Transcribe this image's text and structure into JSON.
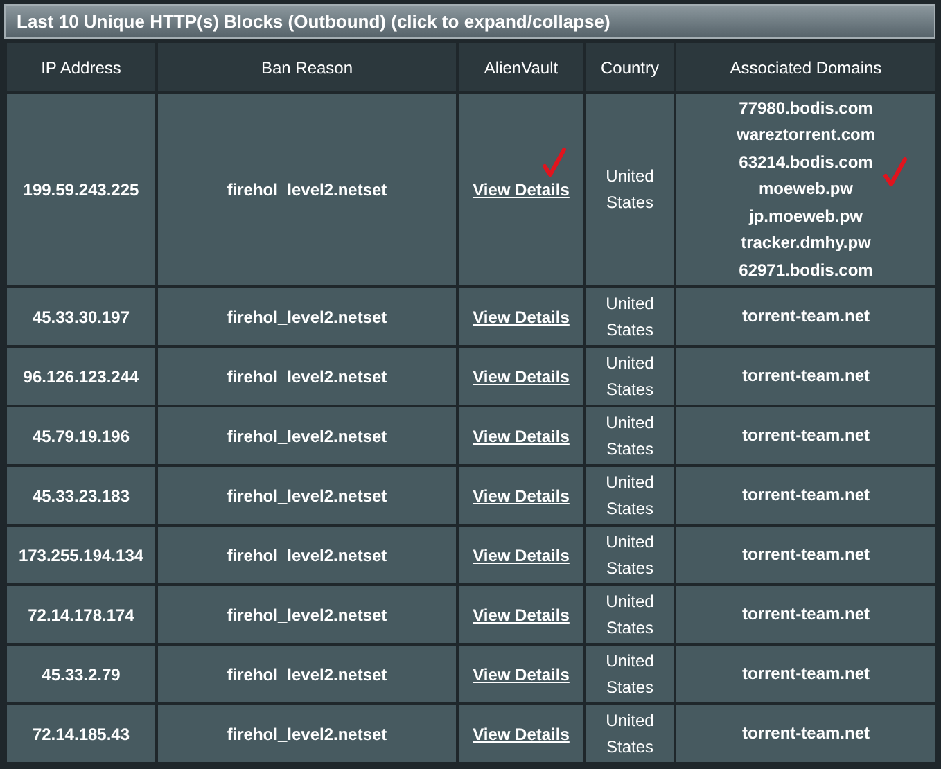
{
  "panel": {
    "title": "Last 10 Unique HTTP(s) Blocks (Outbound) (click to expand/collapse)"
  },
  "table": {
    "columns": [
      "IP Address",
      "Ban Reason",
      "AlienVault",
      "Country",
      "Associated Domains"
    ],
    "rows": [
      {
        "ip": "199.59.243.225",
        "reason": "firehol_level2.netset",
        "link": "View Details",
        "link_checked": true,
        "country": "United States",
        "domains": [
          "77980.bodis.com",
          "wareztorrent.com",
          "63214.bodis.com",
          "moeweb.pw",
          "jp.moeweb.pw",
          "tracker.dmhy.pw",
          "62971.bodis.com"
        ],
        "domains_checked": true
      },
      {
        "ip": "45.33.30.197",
        "reason": "firehol_level2.netset",
        "link": "View Details",
        "country": "United States",
        "domains": [
          "torrent-team.net"
        ]
      },
      {
        "ip": "96.126.123.244",
        "reason": "firehol_level2.netset",
        "link": "View Details",
        "country": "United States",
        "domains": [
          "torrent-team.net"
        ]
      },
      {
        "ip": "45.79.19.196",
        "reason": "firehol_level2.netset",
        "link": "View Details",
        "country": "United States",
        "domains": [
          "torrent-team.net"
        ]
      },
      {
        "ip": "45.33.23.183",
        "reason": "firehol_level2.netset",
        "link": "View Details",
        "country": "United States",
        "domains": [
          "torrent-team.net"
        ]
      },
      {
        "ip": "173.255.194.134",
        "reason": "firehol_level2.netset",
        "link": "View Details",
        "country": "United States",
        "domains": [
          "torrent-team.net"
        ]
      },
      {
        "ip": "72.14.178.174",
        "reason": "firehol_level2.netset",
        "link": "View Details",
        "country": "United States",
        "domains": [
          "torrent-team.net"
        ]
      },
      {
        "ip": "45.33.2.79",
        "reason": "firehol_level2.netset",
        "link": "View Details",
        "country": "United States",
        "domains": [
          "torrent-team.net"
        ]
      },
      {
        "ip": "72.14.185.43",
        "reason": "firehol_level2.netset",
        "link": "View Details",
        "country": "United States",
        "domains": [
          "torrent-team.net"
        ]
      }
    ]
  }
}
